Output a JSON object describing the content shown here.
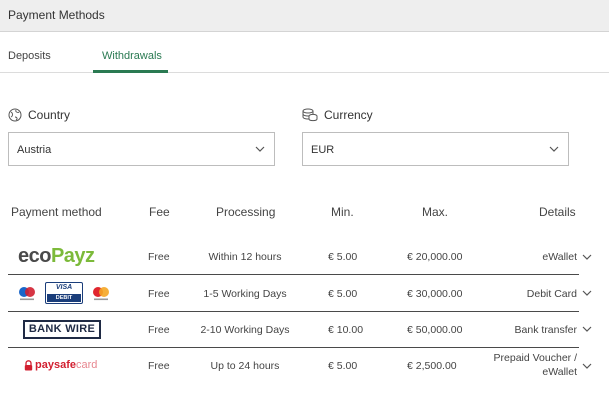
{
  "header": {
    "title": "Payment Methods"
  },
  "tabs": [
    {
      "label": "Deposits",
      "active": false
    },
    {
      "label": "Withdrawals",
      "active": true
    }
  ],
  "accent_color": "#2a7a52",
  "filters": {
    "country": {
      "label": "Country",
      "value": "Austria",
      "icon": "globe-icon"
    },
    "currency": {
      "label": "Currency",
      "value": "EUR",
      "icon": "coins-icon"
    }
  },
  "table": {
    "columns": [
      "Payment method",
      "Fee",
      "Processing",
      "Min.",
      "Max.",
      "Details"
    ],
    "rows": [
      {
        "method": "ecoPayz",
        "method_logo": "ecopayz-logo",
        "fee": "Free",
        "processing": "Within 12 hours",
        "min": "€ 5.00",
        "max": "€ 20,000.00",
        "details": "eWallet"
      },
      {
        "method": "Maestro / Visa Debit / Mastercard",
        "method_logo": "cards-logo",
        "fee": "Free",
        "processing": "1-5 Working Days",
        "min": "€ 5.00",
        "max": "€ 30,000.00",
        "details": "Debit Card"
      },
      {
        "method": "BANK WIRE",
        "method_logo": "bankwire-logo",
        "fee": "Free",
        "processing": "2-10 Working Days",
        "min": "€ 10.00",
        "max": "€ 50,000.00",
        "details": "Bank transfer"
      },
      {
        "method": "paysafecard",
        "method_logo": "paysafecard-logo",
        "fee": "Free",
        "processing": "Up to 24 hours",
        "min": "€ 5.00",
        "max": "€ 2,500.00",
        "details": "Prepaid Voucher / eWallet"
      }
    ]
  },
  "logos": {
    "ecopayz_eco": "eco",
    "ecopayz_payz": "Payz",
    "visa": "VISA",
    "debit": "DEBIT",
    "bankwire": "BANK WIRE",
    "paysafe_a": "paysafe",
    "paysafe_b": "card"
  }
}
